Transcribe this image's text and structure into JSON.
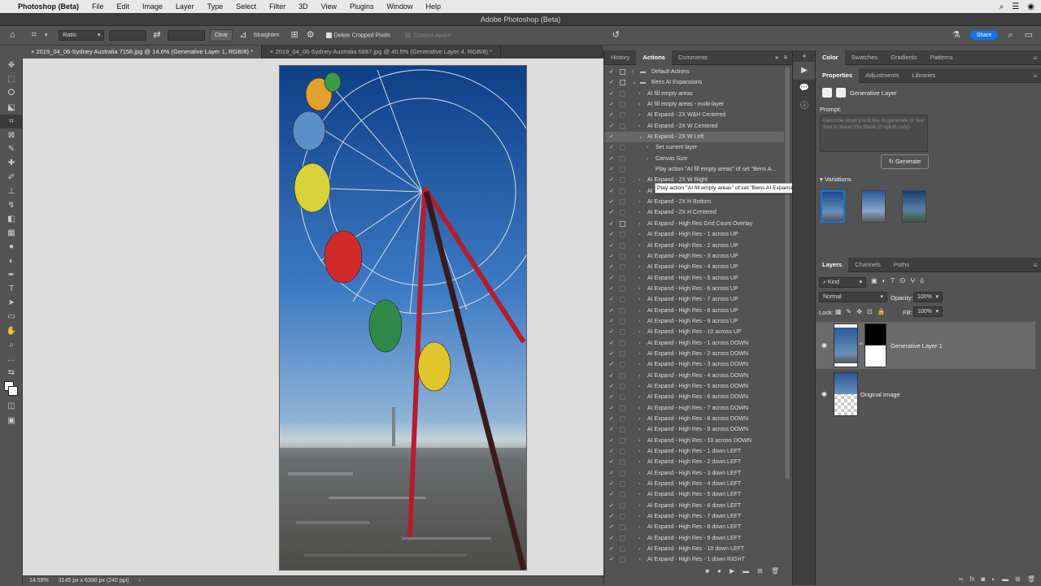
{
  "menubar": {
    "app_name": "Photoshop (Beta)",
    "items": [
      "File",
      "Edit",
      "Image",
      "Layer",
      "Type",
      "Select",
      "Filter",
      "3D",
      "View",
      "Plugins",
      "Window",
      "Help"
    ],
    "right_icons": [
      "search-icon",
      "control-center-icon",
      "siri-icon"
    ]
  },
  "window": {
    "title": "Adobe Photoshop (Beta)"
  },
  "options_bar": {
    "ratio_label": "Ratio",
    "clear_label": "Clear",
    "straighten_label": "Straighten",
    "delete_cropped_label": "Delete Cropped Pixels",
    "content_aware_label": "Content-Aware",
    "share_label": "Share"
  },
  "doc_tabs": [
    {
      "label": "2019_04_06-Sydney Australia 7156.jpg @ 14.6% (Generative Layer 1, RGB/8) *"
    },
    {
      "label": "2019_04_06-Sydney Australia 6887.jpg @ 40.5% (Generative Layer 4, RGB/8) *"
    }
  ],
  "status": {
    "zoom": "14.59%",
    "size": "3145 px x 6390 px (240 ppi)"
  },
  "actions_panel": {
    "tabs": [
      "History",
      "Actions",
      "Comments"
    ],
    "rows": [
      {
        "label": "Default Actions",
        "level": 0,
        "kind": "set",
        "expanded": false,
        "dialog": true
      },
      {
        "label": "Bens AI Expansions",
        "level": 0,
        "kind": "set",
        "expanded": true,
        "dialog": true
      },
      {
        "label": "AI fill empty areas",
        "level": 1,
        "kind": "action"
      },
      {
        "label": "AI fill empty areas - multi-layer",
        "level": 1,
        "kind": "action"
      },
      {
        "label": "AI Expand - 2X W&H Centered",
        "level": 1,
        "kind": "action"
      },
      {
        "label": "AI Expand - 2X W Centered",
        "level": 1,
        "kind": "action"
      },
      {
        "label": "AI Expand - 2X W Left",
        "level": 1,
        "kind": "action",
        "expanded": true,
        "highlight": true
      },
      {
        "label": "Set current layer",
        "level": 2,
        "kind": "step"
      },
      {
        "label": "Canvas Size",
        "level": 2,
        "kind": "step"
      },
      {
        "label": "Play action \"AI fill empty areas\" of set \"Bens A...",
        "level": 2,
        "kind": "step",
        "noarrow": true
      },
      {
        "label": "AI Expand - 2X W Right",
        "level": 1,
        "kind": "action"
      },
      {
        "label": "AI",
        "level": 1,
        "kind": "action"
      },
      {
        "label": "AI Expand - 2X H Bottom",
        "level": 1,
        "kind": "action"
      },
      {
        "label": "AI Expand - 2X H Centered",
        "level": 1,
        "kind": "action"
      },
      {
        "label": "AI Expand - High Res Grid Count Overlay",
        "level": 1,
        "kind": "action",
        "dialog": true
      },
      {
        "label": "AI Expand - High Res - 1 across UP",
        "level": 1,
        "kind": "action"
      },
      {
        "label": "AI Expand - High Res - 2 across UP",
        "level": 1,
        "kind": "action"
      },
      {
        "label": "AI Expand - High Res - 3 across UP",
        "level": 1,
        "kind": "action"
      },
      {
        "label": "AI Expand - High Res - 4 across UP",
        "level": 1,
        "kind": "action"
      },
      {
        "label": "AI Expand - High Res - 5 across UP",
        "level": 1,
        "kind": "action"
      },
      {
        "label": "AI Expand - High Res - 6 across UP",
        "level": 1,
        "kind": "action"
      },
      {
        "label": "AI Expand - High Res - 7 across UP",
        "level": 1,
        "kind": "action"
      },
      {
        "label": "AI Expand - High Res - 8 across UP",
        "level": 1,
        "kind": "action"
      },
      {
        "label": "AI Expand - High Res - 9 across UP",
        "level": 1,
        "kind": "action"
      },
      {
        "label": "AI Expand - High Res - 10 across UP",
        "level": 1,
        "kind": "action"
      },
      {
        "label": "AI Expand - High Res - 1 across DOWN",
        "level": 1,
        "kind": "action"
      },
      {
        "label": "AI Expand - High Res - 2 across DOWN",
        "level": 1,
        "kind": "action"
      },
      {
        "label": "AI Expand - High Res - 3 across DOWN",
        "level": 1,
        "kind": "action"
      },
      {
        "label": "AI Expand - High Res - 4 across DOWN",
        "level": 1,
        "kind": "action"
      },
      {
        "label": "AI Expand - High Res - 5 across DOWN",
        "level": 1,
        "kind": "action"
      },
      {
        "label": "AI Expand - High Res - 6 across DOWN",
        "level": 1,
        "kind": "action"
      },
      {
        "label": "AI Expand - High Res - 7 across DOWN",
        "level": 1,
        "kind": "action"
      },
      {
        "label": "AI Expand - High Res - 8 across DOWN",
        "level": 1,
        "kind": "action"
      },
      {
        "label": "AI Expand - High Res - 9 across DOWN",
        "level": 1,
        "kind": "action"
      },
      {
        "label": "AI Expand - High Res - 10 across DOWN",
        "level": 1,
        "kind": "action"
      },
      {
        "label": "AI Expand - High Res - 1 down LEFT",
        "level": 1,
        "kind": "action"
      },
      {
        "label": "AI Expand - High Res - 2 down LEFT",
        "level": 1,
        "kind": "action"
      },
      {
        "label": "AI Expand - High Res - 3 down LEFT",
        "level": 1,
        "kind": "action"
      },
      {
        "label": "AI Expand - High Res - 4 down LEFT",
        "level": 1,
        "kind": "action"
      },
      {
        "label": "AI Expand - High Res - 5 down LEFT",
        "level": 1,
        "kind": "action"
      },
      {
        "label": "AI Expand - High Res - 6 down LEFT",
        "level": 1,
        "kind": "action"
      },
      {
        "label": "AI Expand - High Res - 7 down LEFT",
        "level": 1,
        "kind": "action"
      },
      {
        "label": "AI Expand - High Res - 8 down LEFT",
        "level": 1,
        "kind": "action"
      },
      {
        "label": "AI Expand - High Res - 9 down LEFT",
        "level": 1,
        "kind": "action"
      },
      {
        "label": "AI Expand - High Res - 10 down LEFT",
        "level": 1,
        "kind": "action"
      },
      {
        "label": "AI Expand - High Res - 1 down RIGHT",
        "level": 1,
        "kind": "action"
      }
    ],
    "tooltip": "Play action \"AI fill empty areas\" of set \"Bens AI Expansions\""
  },
  "color_panel": {
    "tabs": [
      "Color",
      "Swatches",
      "Gradients",
      "Patterns"
    ]
  },
  "properties_panel": {
    "tabs": [
      "Properties",
      "Adjustments",
      "Libraries"
    ],
    "layer_type": "Generative Layer",
    "prompt_label": "Prompt:",
    "prompt_placeholder": "Describe what you'd like to generate or feel free to leave this blank (English only).",
    "generate_label": "Generate",
    "variations_label": "Variations"
  },
  "layers_panel": {
    "tabs": [
      "Layers",
      "Channels",
      "Paths"
    ],
    "filter_kind": "Kind",
    "blend_mode": "Normal",
    "opacity_label": "Opacity:",
    "opacity_value": "100%",
    "lock_label": "Lock:",
    "fill_label": "Fill:",
    "fill_value": "100%",
    "layers": [
      {
        "name": "Generative Layer 1"
      },
      {
        "name": "Original Image"
      }
    ]
  },
  "colors": {
    "accent": "#1473e6",
    "panel_bg": "#535353",
    "canvas_bg": "#dcdcdc"
  }
}
